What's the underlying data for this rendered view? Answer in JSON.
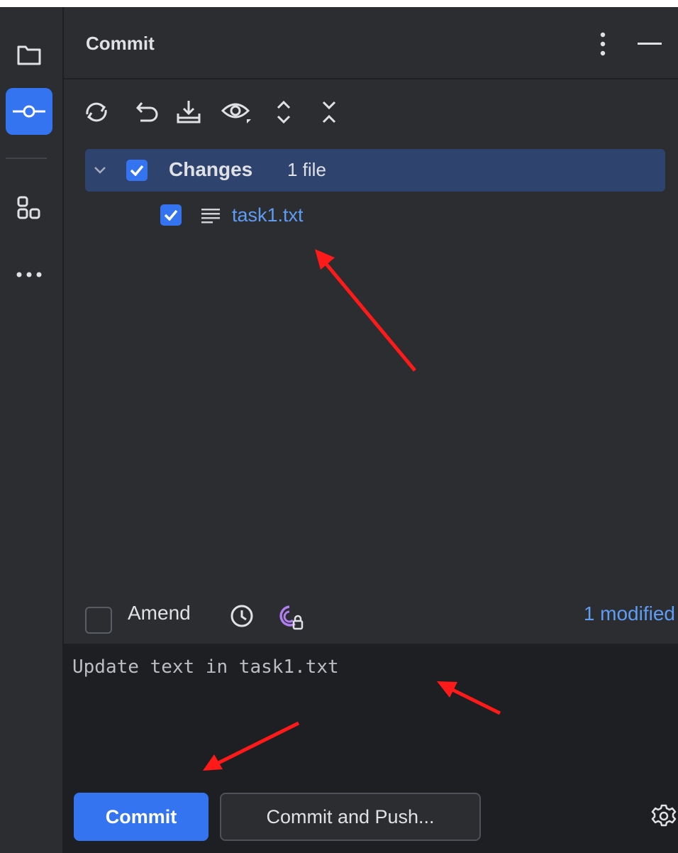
{
  "window": {
    "title": "Commit"
  },
  "toolbar": {
    "buttons": [
      "refresh-icon",
      "rollback-icon",
      "shelve-icon",
      "preview-diff-icon",
      "expand-all-icon",
      "collapse-all-icon"
    ]
  },
  "changes": {
    "group_label": "Changes",
    "group_count": "1 file",
    "files": [
      {
        "name": "task1.txt"
      }
    ]
  },
  "amend": {
    "label": "Amend",
    "modified_text": "1 modified"
  },
  "message": {
    "text": "Update text in task1.txt"
  },
  "footer": {
    "commit_label": "Commit",
    "commit_push_label": "Commit and Push..."
  },
  "colors": {
    "accent": "#3574f0",
    "link": "#5e9cf5",
    "annotation": "#ff1a1a"
  }
}
